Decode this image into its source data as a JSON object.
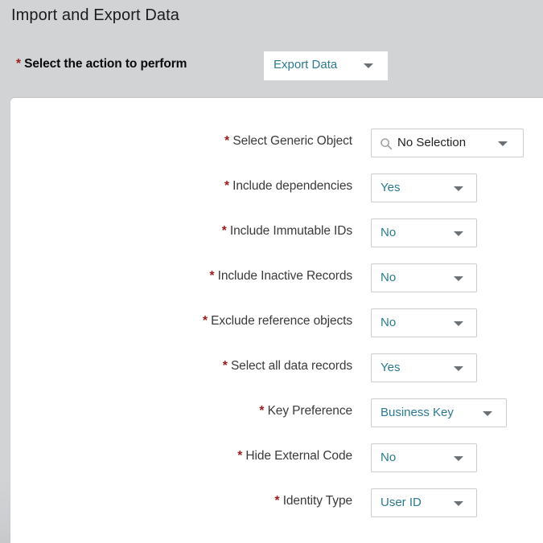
{
  "page": {
    "title": "Import and Export Data",
    "required_marker": "*"
  },
  "action_row": {
    "label": "Select the action to perform",
    "select": {
      "value": "Export Data",
      "icon": "chevron-down-icon"
    }
  },
  "form": {
    "rows": [
      {
        "label": "Select Generic Object",
        "value": "No Selection",
        "width": "wide",
        "has_search_icon": true,
        "value_style": "dark"
      },
      {
        "label": "Include dependencies",
        "value": "Yes",
        "width": "narrow",
        "has_search_icon": false,
        "value_style": "teal"
      },
      {
        "label": "Include Immutable IDs",
        "value": "No",
        "width": "narrow",
        "has_search_icon": false,
        "value_style": "teal"
      },
      {
        "label": "Include Inactive Records",
        "value": "No",
        "width": "narrow",
        "has_search_icon": false,
        "value_style": "teal"
      },
      {
        "label": "Exclude reference objects",
        "value": "No",
        "width": "narrow",
        "has_search_icon": false,
        "value_style": "teal"
      },
      {
        "label": "Select all data records",
        "value": "Yes",
        "width": "narrow",
        "has_search_icon": false,
        "value_style": "teal"
      },
      {
        "label": "Key Preference",
        "value": "Business Key",
        "width": "mid",
        "has_search_icon": false,
        "value_style": "teal"
      },
      {
        "label": "Hide External Code",
        "value": "No",
        "width": "narrow",
        "has_search_icon": false,
        "value_style": "teal"
      },
      {
        "label": "Identity Type",
        "value": "User ID",
        "width": "narrow",
        "has_search_icon": false,
        "value_style": "teal"
      }
    ]
  },
  "colors": {
    "background": "#d1d3d5",
    "card": "#ffffff",
    "value_text": "#2b7a90",
    "label_text": "#3a3a3a",
    "required_asterisk": "#9b1c1c",
    "field_border": "#c8cdd0",
    "caret": "#6a6f73"
  }
}
